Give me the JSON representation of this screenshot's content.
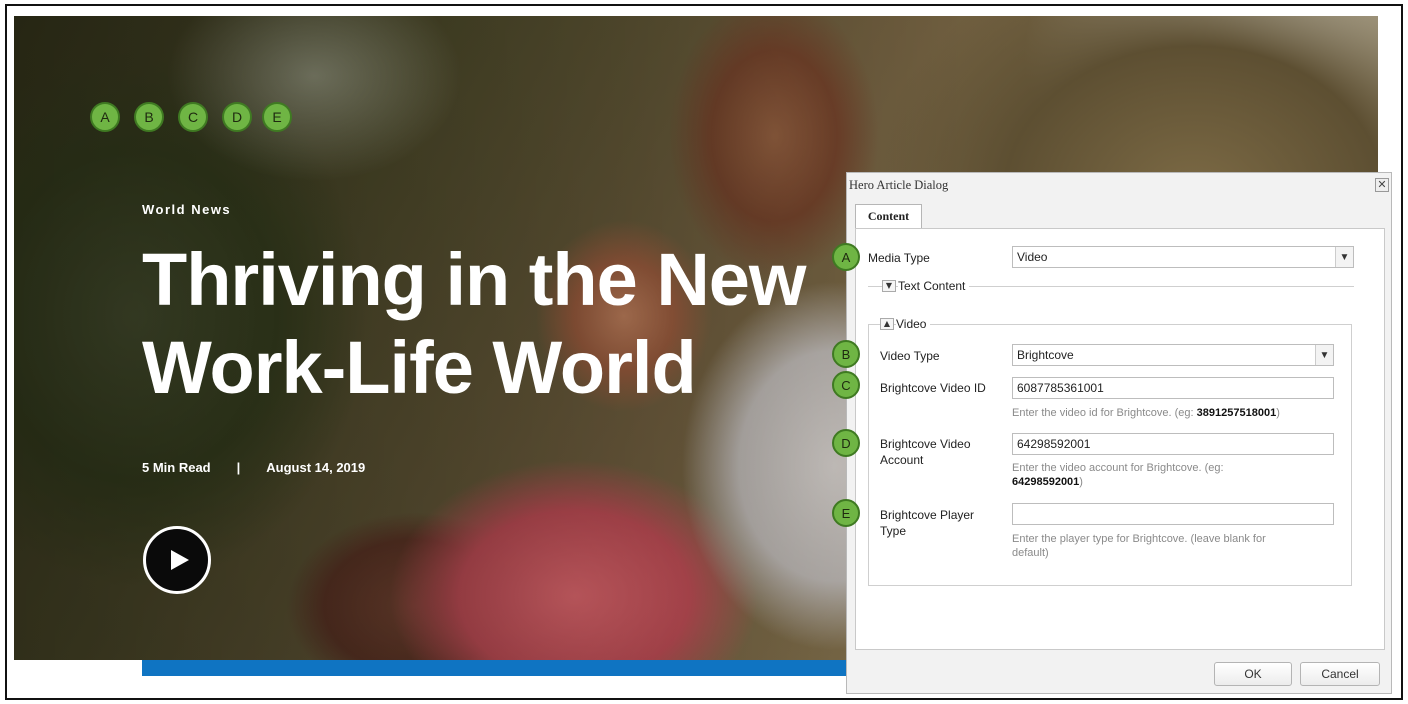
{
  "hero": {
    "steps": [
      "A",
      "B",
      "C",
      "D",
      "E"
    ],
    "eyebrow": "World News",
    "headline_line1": "Thriving in the New",
    "headline_line2": "Work-Life World",
    "read_time": "5 Min Read",
    "separator": "|",
    "date": "August 14, 2019"
  },
  "dialog": {
    "title": "Hero Article Dialog",
    "close_glyph": "✕",
    "tab": "Content",
    "media_type": {
      "marker": "A",
      "label": "Media Type",
      "value": "Video"
    },
    "text_content_section": "Text Content",
    "video_section": "Video",
    "video_type": {
      "marker": "B",
      "label": "Video Type",
      "value": "Brightcove"
    },
    "video_id": {
      "marker": "C",
      "label": "Brightcove Video ID",
      "value": "6087785361001",
      "help_prefix": "Enter the video id for Brightcove. (eg: ",
      "help_example": "3891257518001",
      "help_suffix": ")"
    },
    "video_account": {
      "marker": "D",
      "label_line1": "Brightcove Video",
      "label_line2": "Account",
      "value": "64298592001",
      "help_prefix": "Enter the video account for Brightcove. (eg: ",
      "help_example": "64298592001",
      "help_suffix": ")"
    },
    "player_type": {
      "marker": "E",
      "label_line1": "Brightcove Player",
      "label_line2": "Type",
      "value": "",
      "help_line1": "Enter the player type for Brightcove. (leave blank for",
      "help_line2": "default)"
    },
    "ok_label": "OK",
    "cancel_label": "Cancel"
  },
  "colors": {
    "marker_green": "#6fb544",
    "accent_blue": "#0f74c2"
  },
  "icons": {
    "play": "play-icon",
    "close": "close-icon",
    "chevron": "chevron-down-icon"
  }
}
